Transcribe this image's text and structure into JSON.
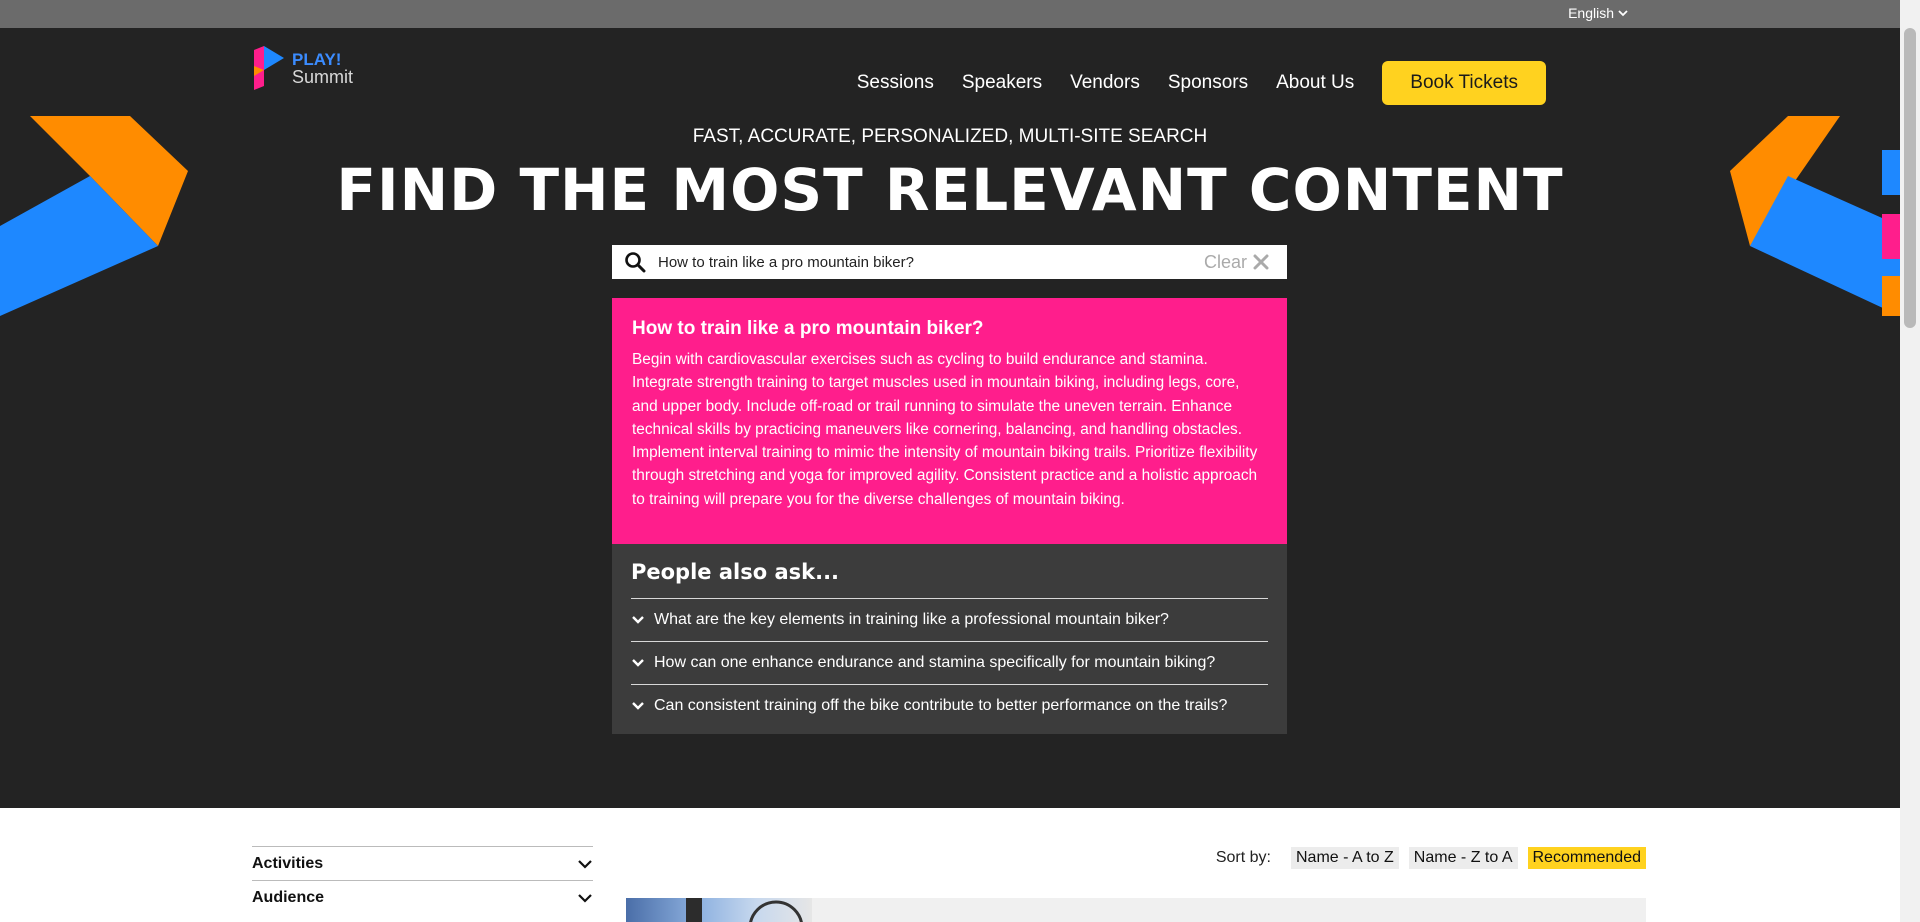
{
  "topbar": {
    "language": "English"
  },
  "logo": {
    "line1": "PLAY!",
    "line2": "Summit"
  },
  "nav": {
    "items": [
      "Sessions",
      "Speakers",
      "Vendors",
      "Sponsors",
      "About Us"
    ],
    "cta": "Book Tickets"
  },
  "hero": {
    "tagline": "FAST, ACCURATE, PERSONALIZED, MULTI-SITE SEARCH",
    "headline": "FIND THE MOST RELEVANT CONTENT"
  },
  "search": {
    "value": "How to train like a pro mountain biker?",
    "clear_label": "Clear"
  },
  "answer": {
    "title": "How to train like a pro mountain biker?",
    "body": "Begin with cardiovascular exercises such as cycling to build endurance and stamina. Integrate strength training to target muscles used in mountain biking, including legs, core, and upper body. Include off-road or trail running to simulate the uneven terrain. Enhance technical skills by practicing maneuvers like cornering, balancing, and handling obstacles. Implement interval training to mimic the intensity of mountain biking trails. Prioritize flexibility through stretching and yoga for improved agility. Consistent practice and a holistic approach to training will prepare you for the diverse challenges of mountain biking."
  },
  "people_also_ask": {
    "title": "People also ask...",
    "questions": [
      "What are the key elements in training like a professional mountain biker?",
      "How can one enhance endurance and stamina specifically for mountain biking?",
      "Can consistent training off the bike contribute to better performance on the trails?"
    ]
  },
  "filters": [
    "Activities",
    "Audience"
  ],
  "sort": {
    "label": "Sort by:",
    "options": [
      "Name - A to Z",
      "Name - Z to A",
      "Recommended"
    ],
    "active": "Recommended"
  },
  "colors": {
    "accent_yellow": "#ffd21f",
    "answer_pink": "#ff1e8c",
    "hero_bg": "#232323",
    "brand_blue": "#1e88ff",
    "brand_orange": "#ff8c00"
  }
}
